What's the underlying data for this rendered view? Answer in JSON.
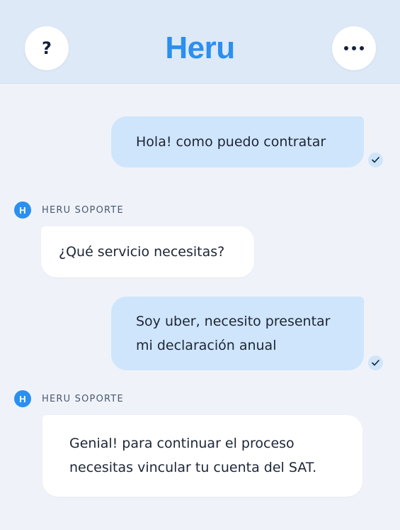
{
  "header": {
    "title": "Heru",
    "help_label": "?",
    "help_icon": "question-icon",
    "more_icon": "ellipsis-icon"
  },
  "colors": {
    "brand": "#2a8ff0",
    "header_bg": "#dde9f6",
    "page_bg": "#eff3f9",
    "user_bubble": "#cfe5fb",
    "bot_bubble": "#ffffff",
    "text": "#1d2536"
  },
  "messages": [
    {
      "from": "user",
      "lines": [
        "Hola! como puedo contratar"
      ],
      "status_icon": "check-icon"
    },
    {
      "from": "bot",
      "sender_initial": "H",
      "sender": "HERU SOPORTE",
      "lines": [
        "¿Qué servicio necesitas?"
      ]
    },
    {
      "from": "user",
      "lines": [
        "Soy uber, necesito presentar",
        "mi declaración anual"
      ],
      "status_icon": "check-icon"
    },
    {
      "from": "bot",
      "sender_initial": "H",
      "sender": "HERU SOPORTE",
      "lines": [
        "Genial! para continuar el proceso",
        "necesitas vincular tu cuenta del SAT."
      ]
    }
  ]
}
